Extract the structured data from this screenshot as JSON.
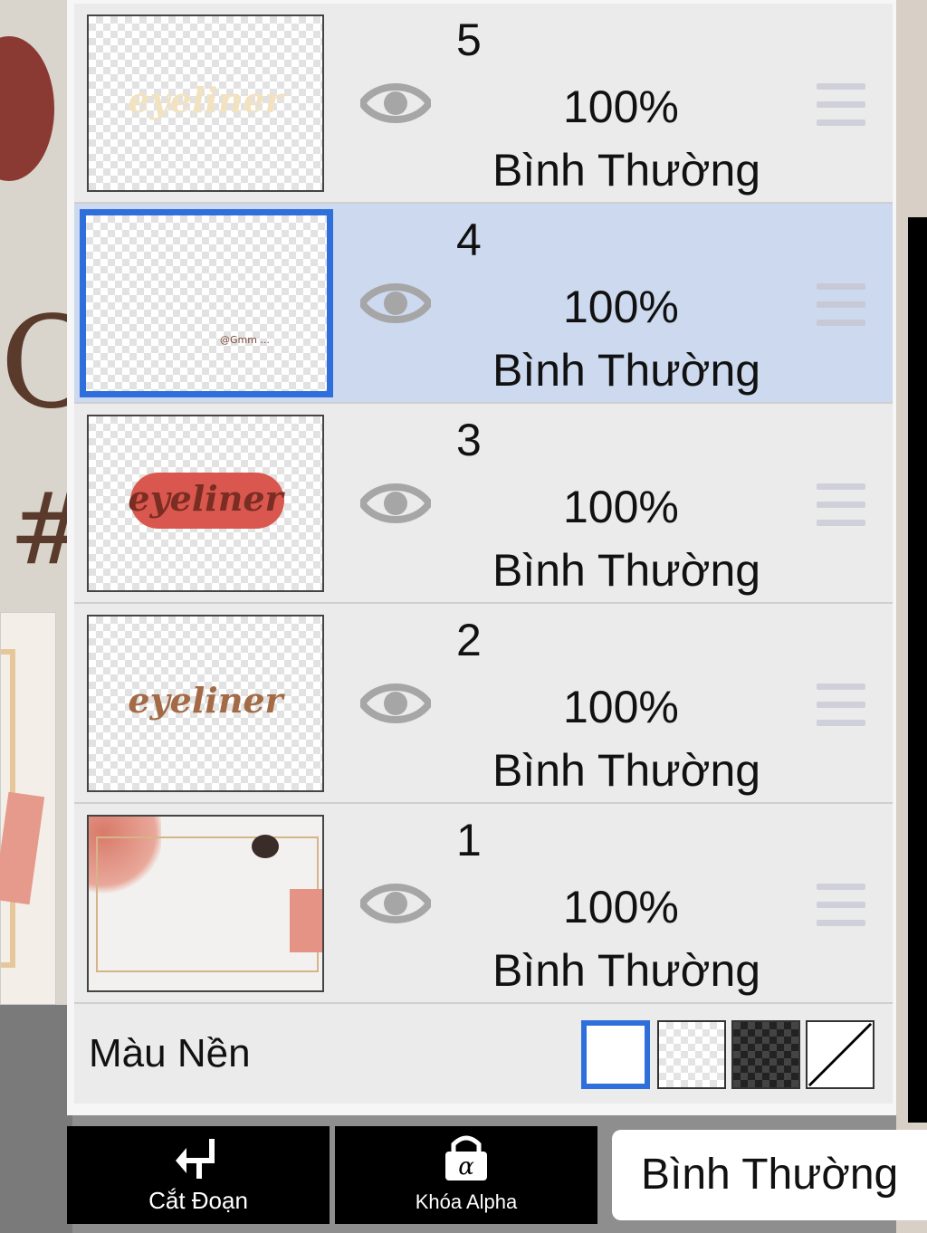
{
  "layers": [
    {
      "number": "5",
      "opacity": "100%",
      "blend": "Bình Thường",
      "thumb_text": "eyeliner",
      "selected": false
    },
    {
      "number": "4",
      "opacity": "100%",
      "blend": "Bình Thường",
      "thumb_text": "@Gmm ...",
      "selected": true
    },
    {
      "number": "3",
      "opacity": "100%",
      "blend": "Bình Thường",
      "thumb_text": "eyeliner",
      "selected": false
    },
    {
      "number": "2",
      "opacity": "100%",
      "blend": "Bình Thường",
      "thumb_text": "eyeliner",
      "selected": false
    },
    {
      "number": "1",
      "opacity": "100%",
      "blend": "Bình Thường",
      "thumb_text": "",
      "selected": false
    }
  ],
  "background_color": {
    "label": "Màu Nền",
    "options": [
      "white",
      "transparent-light",
      "transparent-dark",
      "none"
    ],
    "selected": "white"
  },
  "toolbar": {
    "cut_label": "Cắt Đoạn",
    "alpha_lock_label": "Khóa Alpha",
    "blend_mode_label": "Bình Thường"
  },
  "colors": {
    "selection_blue": "#2f6fdc",
    "selected_row": "#ccd9ee",
    "row_bg": "#ebebeb"
  },
  "icons": [
    "eye-icon",
    "drag-handle-icon",
    "cut-arrow-icon",
    "alpha-lock-icon"
  ]
}
